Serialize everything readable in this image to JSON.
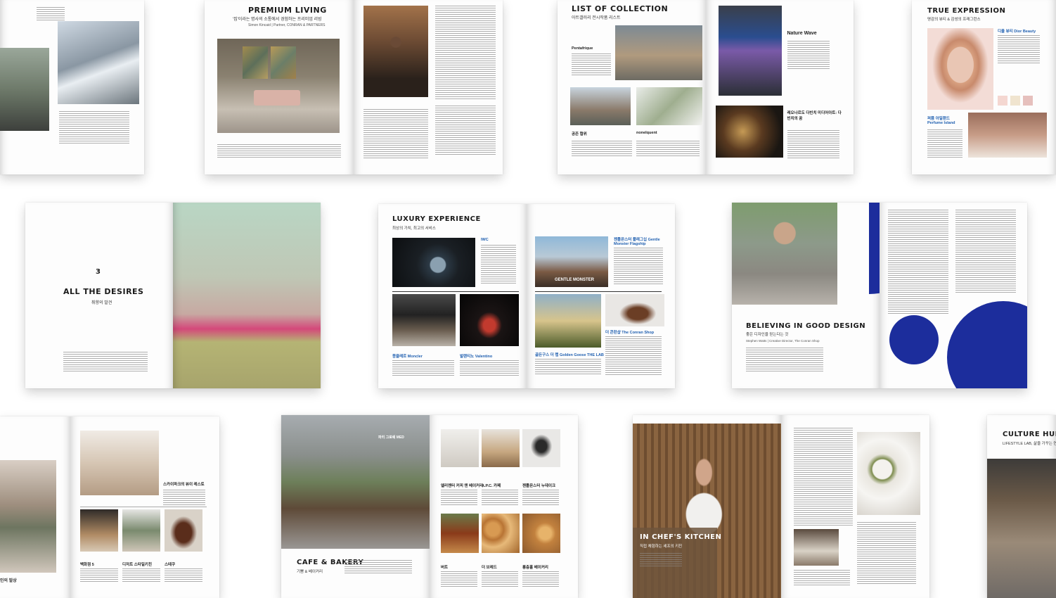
{
  "spreads": {
    "premium_living": {
      "title": "PREMIUM LIVING",
      "subtitle": "'집'이라는 명사의 소통에서 경험하는 프리미엄 리빙",
      "byline": "Simon Kincaid | Partner, CONRAN & PARTNERS"
    },
    "list_of_collection": {
      "title": "LIST OF COLLECTION",
      "subtitle": "아트갤러리 전시작품 리스트",
      "item1": "Pentafrique",
      "item2": "Nature Wave",
      "item3": "공존 협위",
      "item4": "nonelquent",
      "item5": "레오나르도 다빈치 미디어아트: 다빈치의 꿈"
    },
    "true_expression": {
      "title": "TRUE EXPRESSION",
      "subtitle": "명감의 뷰티 & 감성의 프래그런스",
      "brand1": "디올 뷰티 Dior Beauty",
      "brand2": "퍼퓸 아일랜드 Perfume Island"
    },
    "all_the_desires": {
      "number": "3",
      "title": "ALL THE DESIRES",
      "subtitle": "취향의 발견"
    },
    "luxury_experience": {
      "title": "LUXURY EXPERIENCE",
      "subtitle": "최상의 가치, 최고의 서비스",
      "brand1": "IWC",
      "brand2": "젠틀몬스터 플래그십 Gentle Monster Flagship",
      "brand3": "몽클레르 Moncler",
      "brand4": "발렌티노 Valentino",
      "brand5": "골든구스 더 랩 Golden Goose THE LAB",
      "brand6": "더 콘란샵 The Conran Shop",
      "overlay": "GENTLE MONSTER"
    },
    "believing": {
      "title": "BELIEVING IN GOOD DESIGN",
      "subtitle": "좋은 디자인을 믿는다는 것",
      "byline": "Stephen Watts | Creative Director, The Conran Shop"
    },
    "interior": {
      "cap1": "스카이파크의 뷰이 레스토",
      "cap2": "백화점 5",
      "cap3": "디저트 스타일키친",
      "cap4": "스테쿠",
      "cropped": "인의 발상"
    },
    "cafe_bakery": {
      "title": "CAFE & BAKERY",
      "subtitle": "기쁨 & 베이커리",
      "cap1": "엘리멘터 커피 앤 베이커리",
      "cap2": "A.P.C. 카페",
      "cap3": "젠틀몬스터 누데이크",
      "cap4": "버트",
      "cap5": "더 브레드",
      "cap6": "롱층흘 베이커리",
      "overlay_note": "파리 그로쉐 MED"
    },
    "chefs_kitchen": {
      "title": "IN CHEF'S KITCHEN",
      "subtitle": "직접 체험하는 셰프의 키친"
    },
    "culture_hub": {
      "title": "CULTURE HUB",
      "subtitle": "LIFESTYLE LAB, 삶을 가꾸는 연구"
    }
  },
  "colors": {
    "accent_blue": "#1c2d9c",
    "link_blue": "#1f5fb0"
  }
}
